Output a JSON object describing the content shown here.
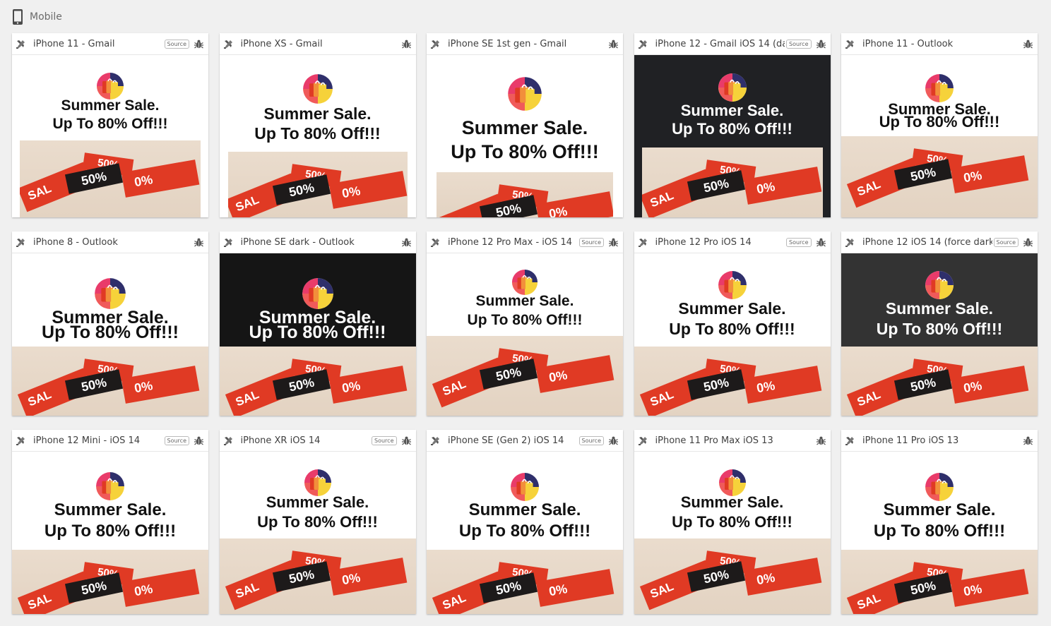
{
  "section": {
    "title": "Mobile",
    "icon": "mobile-phone-icon"
  },
  "email": {
    "headline_line1": "Summer Sale.",
    "headline_line2": "Up To 80% Off!!!",
    "tag_text": "50%",
    "tag_side_a": "SAL",
    "tag_side_b": "0%"
  },
  "colors": {
    "brand_red": "#e03a24",
    "dark_tag": "#1d1a1a",
    "banner_bg": "#e7d8c8"
  },
  "source_label": "Source",
  "cards": [
    {
      "title": "iPhone 11 - Gmail",
      "source": true,
      "theme": "light"
    },
    {
      "title": "iPhone XS - Gmail",
      "source": false,
      "theme": "light"
    },
    {
      "title": "iPhone SE 1st gen - Gmail",
      "source": false,
      "theme": "light"
    },
    {
      "title": "iPhone 12 - Gmail iOS 14 (da",
      "source": true,
      "theme": "dark"
    },
    {
      "title": "iPhone 11 - Outlook",
      "source": false,
      "theme": "light"
    },
    {
      "title": "iPhone 8 - Outlook",
      "source": false,
      "theme": "light"
    },
    {
      "title": "iPhone SE dark - Outlook",
      "source": false,
      "theme": "dark"
    },
    {
      "title": "iPhone 12 Pro Max - iOS 14",
      "source": true,
      "theme": "light"
    },
    {
      "title": "iPhone 12 Pro iOS 14",
      "source": true,
      "theme": "light"
    },
    {
      "title": "iPhone 12 iOS 14 (force dark",
      "source": true,
      "theme": "gray"
    },
    {
      "title": "iPhone 12 Mini - iOS 14",
      "source": true,
      "theme": "light"
    },
    {
      "title": "iPhone XR iOS 14",
      "source": true,
      "theme": "light"
    },
    {
      "title": "iPhone SE (Gen 2) iOS 14",
      "source": true,
      "theme": "light"
    },
    {
      "title": "iPhone 11 Pro Max iOS 13",
      "source": false,
      "theme": "light"
    },
    {
      "title": "iPhone 11 Pro iOS 13",
      "source": false,
      "theme": "light"
    }
  ]
}
